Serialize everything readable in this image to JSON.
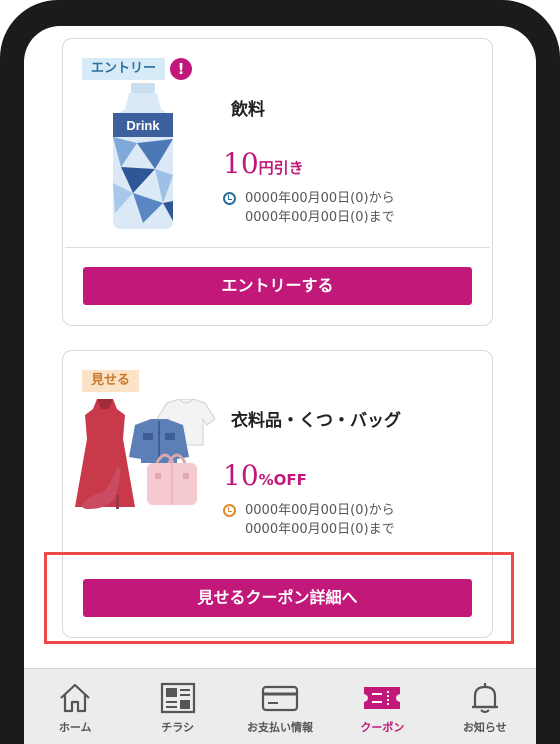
{
  "coupons": [
    {
      "tag": "エントリー",
      "alert": "!",
      "title": "飲料",
      "image_label": "Drink",
      "discount_value": "10",
      "discount_unit": "円引き",
      "period_from": "0000年00月00日(0)から",
      "period_to": "0000年00月00日(0)まで",
      "button_label": "エントリーする"
    },
    {
      "tag": "見せる",
      "title": "衣料品・くつ・バッグ",
      "discount_value": "10",
      "discount_unit": "%OFF",
      "period_from": "0000年00月00日(0)から",
      "period_to": "0000年00月00日(0)まで",
      "button_label": "見せるクーポン詳細へ"
    }
  ],
  "tabbar": {
    "items": [
      {
        "label": "ホーム",
        "icon": "home-icon",
        "active": false
      },
      {
        "label": "チラシ",
        "icon": "flyer-icon",
        "active": false
      },
      {
        "label": "お支払い情報",
        "icon": "card-icon",
        "active": false
      },
      {
        "label": "クーポン",
        "icon": "coupon-icon",
        "active": true
      },
      {
        "label": "お知らせ",
        "icon": "bell-icon",
        "active": false
      }
    ]
  },
  "colors": {
    "accent": "#c2187a",
    "highlight": "#ee4a4a",
    "entry_tag_bg": "#d6eaf7",
    "show_tag_bg": "#fbe3c8"
  }
}
